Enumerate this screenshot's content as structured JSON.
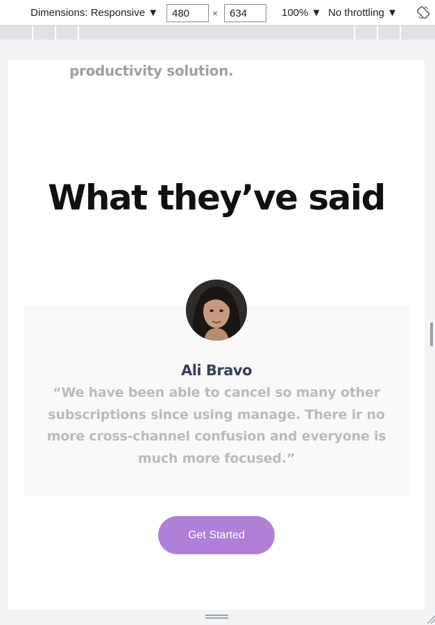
{
  "devtools": {
    "dimensions_label": "Dimensions: Responsive ▼",
    "width_value": "480",
    "times_symbol": "×",
    "height_value": "634",
    "zoom_label": "100% ▼",
    "throttling_label": "No throttling ▼"
  },
  "page": {
    "intro_tail": "productivity solution.",
    "section_title": "What they’ve said",
    "testimonial": {
      "name": "Ali Bravo",
      "quote": "“We have been able to cancel so many other subscriptions since using manage. There ir no more cross-channel confusion and everyone is much more focused.”"
    },
    "cta_label": "Get Started"
  },
  "colors": {
    "cta": "#b07fd6",
    "card_bg": "#f9f9f9",
    "name": "#3a3f5c",
    "quote": "#b9bbc0"
  }
}
